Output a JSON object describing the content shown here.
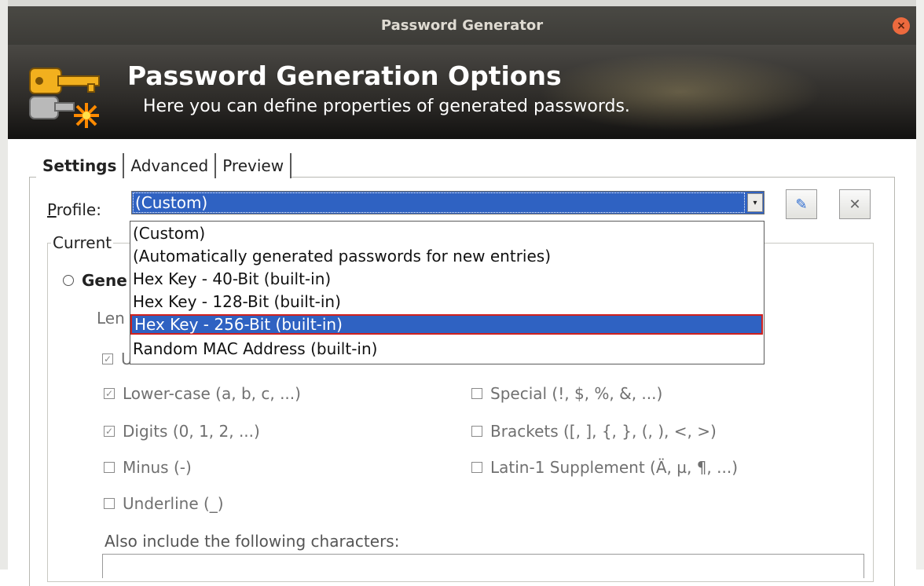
{
  "window": {
    "title": "Password Generator",
    "close_icon": "×"
  },
  "banner": {
    "title": "Password Generation Options",
    "subtitle": "Here you can define properties of generated passwords."
  },
  "tabs": [
    {
      "label": "Settings",
      "active": true
    },
    {
      "label": "Advanced",
      "active": false
    },
    {
      "label": "Preview",
      "active": false
    }
  ],
  "profile": {
    "label_prefix": "P",
    "label_rest": "rofile:",
    "selected": "(Custom)",
    "arrow": "▾",
    "options": [
      "(Custom)",
      "(Automatically generated passwords for new entries)",
      "Hex Key - 40-Bit (built-in)",
      "Hex Key - 128-Bit (built-in)",
      "Hex Key - 256-Bit (built-in)",
      "Random MAC Address (built-in)"
    ],
    "highlighted_index": 4
  },
  "settings": {
    "group_label": "Current",
    "radio_label": "Gene",
    "length_label": "Len",
    "options_left": [
      {
        "label": "Lower-case (a, b, c, ...)",
        "checked": true
      },
      {
        "label": "Digits (0, 1, 2, ...)",
        "checked": true
      },
      {
        "label": "Minus (-)",
        "checked": false
      },
      {
        "label": "Underline (_)",
        "checked": false
      }
    ],
    "options_right": [
      {
        "label": "Special (!, $, %, &, ...)",
        "checked": false
      },
      {
        "label": "Brackets ([, ], {, }, (, ), <, >)",
        "checked": false
      },
      {
        "label": "Latin-1 Supplement (Ä, µ, ¶, ...)",
        "checked": false
      }
    ],
    "partial_checkbox_label": "U",
    "also_include_label": "Also include the following characters:"
  },
  "colors": {
    "selection": "#2f62c2",
    "highlight_border": "#d0211e",
    "titlebar": "#3c3b37"
  }
}
